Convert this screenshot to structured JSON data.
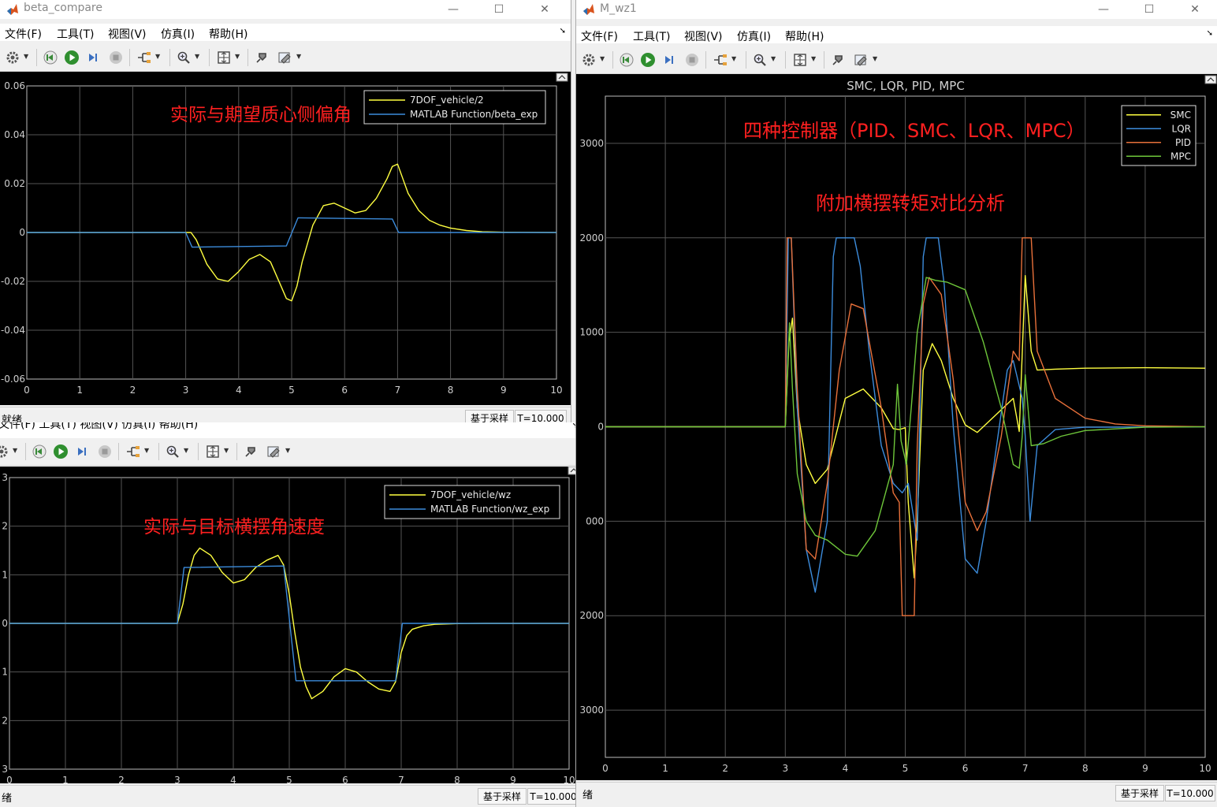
{
  "menu": [
    "文件(F)",
    "工具(T)",
    "视图(V)",
    "仿真(I)",
    "帮助(H)"
  ],
  "status": {
    "ready": "就绪",
    "ready_partial": "绪",
    "mode": "基于采样",
    "time": "T=10.000"
  },
  "win_left_top": {
    "title": "beta_compare"
  },
  "win_right": {
    "title": "M_wz1"
  },
  "win_left_bottom": {
    "menu_partial": "文件(F)   工具(T)   视图(V)   仿真(I)   帮助(H)"
  },
  "colors": {
    "yellow": "#ffff40",
    "blue": "#3c8cdc",
    "orange": "#e8703a",
    "green": "#6ec63a",
    "annotation": "#ff2020",
    "axes_bg": "#000000",
    "grid": "#555555"
  },
  "icons": [
    "gear-icon",
    "step-back-icon",
    "run-icon",
    "step-forward-icon",
    "stop-icon",
    "signal-select-icon",
    "zoom-icon",
    "fit-to-view-icon",
    "highlight-icon",
    "style-icon"
  ],
  "chart_data": [
    {
      "id": "beta",
      "type": "line",
      "annotation": "实际与期望质心侧偏角",
      "xlim": [
        0,
        10
      ],
      "ylim": [
        -0.06,
        0.06
      ],
      "xticks": [
        "0",
        "1",
        "2",
        "3",
        "4",
        "5",
        "6",
        "7",
        "8",
        "9",
        "10"
      ],
      "yticks": [
        {
          "v": 0.06,
          "label": "0.06"
        },
        {
          "v": 0.04,
          "label": "0.04"
        },
        {
          "v": 0.02,
          "label": "0.02"
        },
        {
          "v": 0,
          "label": "0"
        },
        {
          "v": -0.02,
          "label": "-0.02"
        },
        {
          "v": -0.04,
          "label": "-0.04"
        },
        {
          "v": -0.06,
          "label": "-0.06"
        }
      ],
      "series": [
        {
          "name": "7DOF_vehicle/2",
          "color": "#ffff40",
          "x": [
            0,
            3.0,
            3.1,
            3.2,
            3.3,
            3.4,
            3.6,
            3.8,
            4.0,
            4.2,
            4.4,
            4.6,
            4.8,
            4.9,
            5.0,
            5.1,
            5.2,
            5.4,
            5.6,
            5.8,
            6.0,
            6.2,
            6.4,
            6.6,
            6.8,
            6.9,
            7.0,
            7.1,
            7.2,
            7.4,
            7.6,
            7.8,
            8.0,
            8.3,
            8.6,
            9.0,
            10
          ],
          "y": [
            0,
            0,
            0,
            -0.003,
            -0.008,
            -0.013,
            -0.019,
            -0.02,
            -0.016,
            -0.011,
            -0.009,
            -0.012,
            -0.022,
            -0.027,
            -0.028,
            -0.022,
            -0.012,
            0.003,
            0.011,
            0.012,
            0.01,
            0.008,
            0.009,
            0.014,
            0.022,
            0.027,
            0.028,
            0.022,
            0.016,
            0.009,
            0.005,
            0.003,
            0.0018,
            0.0008,
            0.0003,
            0.0001,
            0
          ]
        },
        {
          "name": "MATLAB Function/beta_exp",
          "color": "#3c8cdc",
          "x": [
            0,
            3.0,
            3.12,
            4.9,
            5.12,
            6.9,
            7.02,
            10
          ],
          "y": [
            0,
            0,
            -0.006,
            -0.0055,
            0.006,
            0.0055,
            0,
            0
          ]
        }
      ]
    },
    {
      "id": "wz",
      "type": "line",
      "annotation": "实际与目标横摆角速度",
      "xlim": [
        0,
        10
      ],
      "ylim": [
        -0.3,
        0.3
      ],
      "xticks": [
        "0",
        "1",
        "2",
        "3",
        "4",
        "5",
        "6",
        "7",
        "8",
        "9",
        "10"
      ],
      "yticks": [
        {
          "v": 0.3,
          "label": "3"
        },
        {
          "v": 0.2,
          "label": "2"
        },
        {
          "v": 0.1,
          "label": "1"
        },
        {
          "v": 0,
          "label": "0"
        },
        {
          "v": -0.1,
          "label": "1"
        },
        {
          "v": -0.2,
          "label": "2"
        },
        {
          "v": -0.3,
          "label": "3"
        }
      ],
      "series": [
        {
          "name": "7DOF_vehicle/wz",
          "color": "#ffff40",
          "x": [
            0,
            3.0,
            3.1,
            3.2,
            3.3,
            3.4,
            3.6,
            3.8,
            4.0,
            4.2,
            4.4,
            4.6,
            4.8,
            4.9,
            5.0,
            5.1,
            5.2,
            5.3,
            5.4,
            5.6,
            5.8,
            6.0,
            6.2,
            6.4,
            6.6,
            6.8,
            6.9,
            7.0,
            7.1,
            7.2,
            7.4,
            7.6,
            8.0,
            8.5,
            10
          ],
          "y": [
            0,
            0,
            0.04,
            0.1,
            0.14,
            0.155,
            0.14,
            0.105,
            0.083,
            0.09,
            0.115,
            0.13,
            0.14,
            0.12,
            0.06,
            -0.02,
            -0.09,
            -0.13,
            -0.155,
            -0.14,
            -0.11,
            -0.093,
            -0.1,
            -0.12,
            -0.135,
            -0.14,
            -0.12,
            -0.06,
            -0.025,
            -0.012,
            -0.005,
            -0.002,
            -0.0005,
            0,
            0
          ]
        },
        {
          "name": "MATLAB Function/wz_exp",
          "color": "#3c8cdc",
          "x": [
            0,
            3.0,
            3.12,
            4.9,
            5.12,
            6.9,
            7.02,
            10
          ],
          "y": [
            0,
            0,
            0.115,
            0.118,
            -0.118,
            -0.118,
            0,
            0
          ]
        }
      ]
    },
    {
      "id": "mz",
      "type": "line",
      "title": "SMC, LQR, PID, MPC",
      "annotation_1": "四种控制器（PID、SMC、LQR、MPC）",
      "annotation_2": "附加横摆转矩对比分析",
      "xlim": [
        0,
        10
      ],
      "ylim": [
        -3500,
        3500
      ],
      "xticks": [
        "0",
        "1",
        "2",
        "3",
        "4",
        "5",
        "6",
        "7",
        "8",
        "9",
        "10"
      ],
      "yticks": [
        {
          "v": 3000,
          "label": "3000"
        },
        {
          "v": 2000,
          "label": "2000"
        },
        {
          "v": 1000,
          "label": "1000"
        },
        {
          "v": 0,
          "label": "0"
        },
        {
          "v": -1000,
          "label": "000"
        },
        {
          "v": -2000,
          "label": "2000"
        },
        {
          "v": -3000,
          "label": "3000"
        }
      ],
      "series": [
        {
          "name": "SMC",
          "color": "#ffff40",
          "x": [
            0,
            3.0,
            3.06,
            3.12,
            3.2,
            3.35,
            3.5,
            3.7,
            4.0,
            4.3,
            4.6,
            4.8,
            4.9,
            5.0,
            5.05,
            5.15,
            5.2,
            5.3,
            5.45,
            5.6,
            5.8,
            6.0,
            6.2,
            6.5,
            6.8,
            6.9,
            7.0,
            7.1,
            7.2,
            7.5,
            8,
            9,
            10
          ],
          "y": [
            0,
            0,
            900,
            1150,
            200,
            -400,
            -600,
            -450,
            300,
            400,
            200,
            -20,
            -30,
            -10,
            -800,
            -1600,
            -1000,
            600,
            880,
            700,
            300,
            20,
            -60,
            120,
            300,
            -50,
            1600,
            800,
            600,
            610,
            620,
            625,
            620
          ]
        },
        {
          "name": "LQR",
          "color": "#3c8cdc",
          "x": [
            0,
            3.0,
            3.05,
            3.1,
            3.2,
            3.35,
            3.5,
            3.7,
            3.8,
            3.85,
            4.15,
            4.25,
            4.4,
            4.6,
            4.8,
            4.95,
            5.05,
            5.2,
            5.3,
            5.35,
            5.55,
            5.65,
            5.8,
            6.0,
            6.2,
            6.35,
            6.5,
            6.7,
            6.8,
            6.95,
            7.0,
            7.08,
            7.2,
            7.5,
            8,
            10
          ],
          "y": [
            0,
            0,
            2000,
            2000,
            200,
            -1300,
            -1750,
            -1000,
            1800,
            2000,
            2000,
            1700,
            800,
            -200,
            -600,
            -700,
            -600,
            -1200,
            1800,
            2000,
            2000,
            1500,
            0,
            -1400,
            -1550,
            -1000,
            -300,
            600,
            700,
            300,
            -100,
            -1000,
            -200,
            -30,
            -5,
            0
          ]
        },
        {
          "name": "PID",
          "color": "#e8703a",
          "x": [
            0,
            3.0,
            3.03,
            3.1,
            3.2,
            3.35,
            3.5,
            3.7,
            3.9,
            4.1,
            4.3,
            4.6,
            4.8,
            4.9,
            4.95,
            5.15,
            5.2,
            5.3,
            5.4,
            5.6,
            5.8,
            6.0,
            6.2,
            6.35,
            6.6,
            6.8,
            6.9,
            6.95,
            7.1,
            7.2,
            7.5,
            8.0,
            8.5,
            9,
            10
          ],
          "y": [
            0,
            0,
            2000,
            2000,
            400,
            -1300,
            -1400,
            -600,
            600,
            1300,
            1250,
            200,
            -700,
            -800,
            -2000,
            -2000,
            -200,
            1300,
            1580,
            1400,
            500,
            -800,
            -1100,
            -900,
            -100,
            800,
            700,
            2000,
            2000,
            800,
            300,
            90,
            30,
            10,
            0
          ]
        },
        {
          "name": "MPC",
          "color": "#6ec63a",
          "x": [
            0,
            3.0,
            3.07,
            3.12,
            3.2,
            3.35,
            3.5,
            3.7,
            4.0,
            4.2,
            4.5,
            4.8,
            4.87,
            4.93,
            5.02,
            5.1,
            5.2,
            5.35,
            5.5,
            5.7,
            6.0,
            6.3,
            6.6,
            6.8,
            6.9,
            6.95,
            7.0,
            7.1,
            7.3,
            7.6,
            8,
            9,
            10
          ],
          "y": [
            0,
            0,
            1100,
            400,
            -500,
            -1000,
            -1150,
            -1200,
            -1350,
            -1370,
            -1100,
            -400,
            450,
            -150,
            -400,
            200,
            1000,
            1580,
            1550,
            1530,
            1450,
            900,
            200,
            -400,
            -440,
            -100,
            550,
            -200,
            -180,
            -100,
            -40,
            -5,
            0
          ]
        }
      ]
    }
  ]
}
